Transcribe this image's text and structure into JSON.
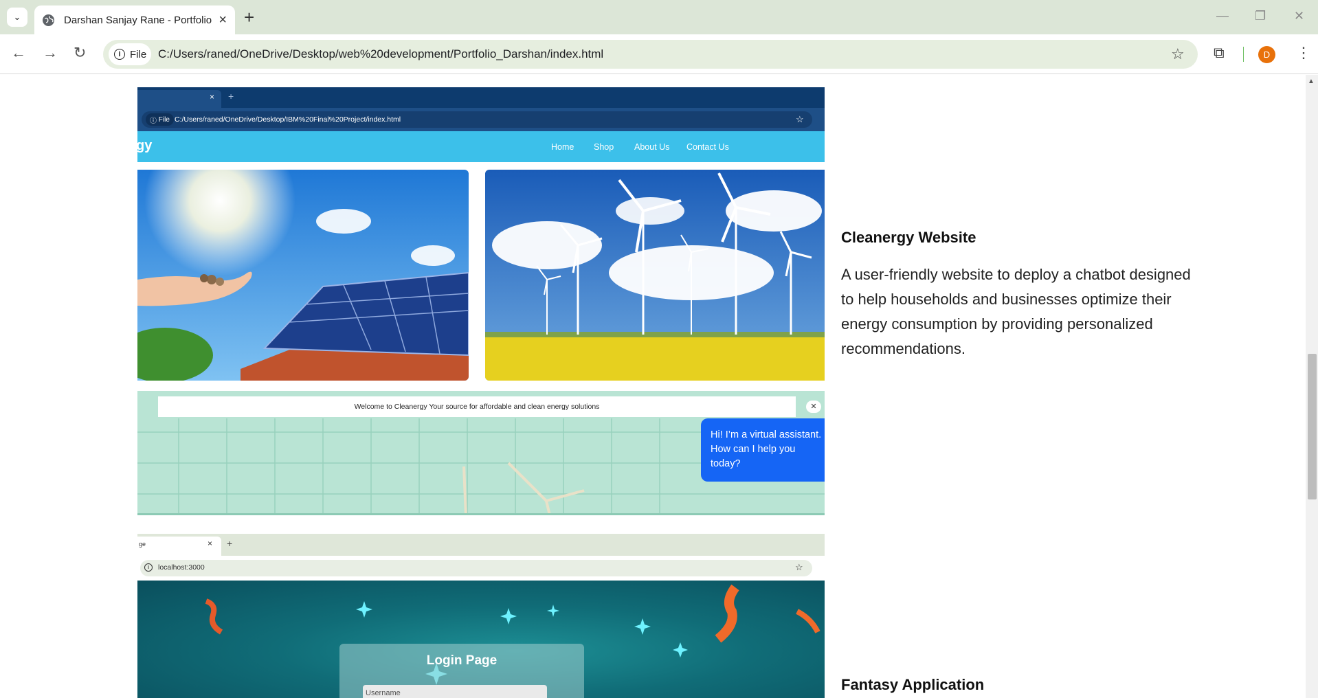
{
  "browser": {
    "tab_title": "Darshan Sanjay Rane - Portfolio",
    "file_chip": "File",
    "url": "C:/Users/raned/OneDrive/Desktop/web%20development/Portfolio_Darshan/index.html",
    "profile_initial": "D"
  },
  "cleanergy_screenshot": {
    "tab_close": "×",
    "file_chip": "File",
    "url": "C:/Users/raned/OneDrive/Desktop/IBM%20Final%20Project/index.html",
    "brand_fragment": "gy",
    "nav": [
      "Home",
      "Shop",
      "About Us",
      "Contact Us"
    ],
    "banner": "Welcome to Cleanergy Your source for affordable and clean energy solutions",
    "chat_bubble": "Hi! I’m a virtual assistant. How can I help you today?"
  },
  "login_screenshot": {
    "tab_title_fragment": "ge",
    "url": "localhost:3000",
    "card_title": "Login Page",
    "username_placeholder": "Username"
  },
  "projects": [
    {
      "title": "Cleanergy Website",
      "description": "A user-friendly website to deploy a chatbot designed to help households and businesses optimize their energy consumption by providing personalized recommendations."
    },
    {
      "title": "Fantasy Application"
    }
  ]
}
